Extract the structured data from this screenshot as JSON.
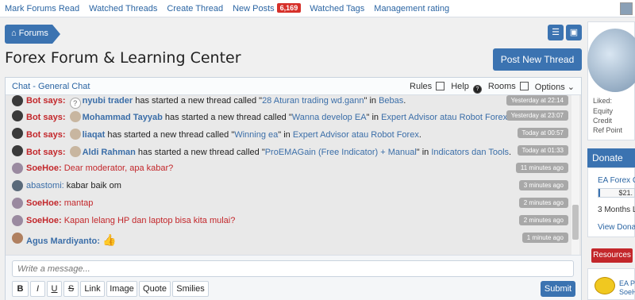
{
  "topnav": {
    "items": [
      "Mark Forums Read",
      "Watched Threads",
      "Create Thread",
      "New Posts"
    ],
    "new_posts_count": "6,169",
    "items2": [
      "Watched Tags",
      "Management rating"
    ]
  },
  "breadcrumb": {
    "label": "Forums"
  },
  "page": {
    "title": "Forex Forum & Learning Center",
    "post_button": "Post New Thread"
  },
  "chat": {
    "title": "Chat - General Chat",
    "tools": {
      "rules": "Rules",
      "help": "Help",
      "rooms": "Rooms",
      "options": "Options"
    },
    "messages": [
      {
        "speaker": "Bot says:",
        "user": "nyubi trader",
        "text": " has started a new thread called \"",
        "link": "28 Aturan trading wd.gann",
        "mid": "\" in ",
        "forum": "Bebas",
        "end": ".",
        "time": "Yesterday at 22:14"
      },
      {
        "speaker": "Bot says:",
        "user": "Mohammad Tayyab",
        "text": " has started a new thread called \"",
        "link": "Wanna develop EA",
        "mid": "\" in ",
        "forum": "Expert Advisor atau Robot Forex",
        "end": ".",
        "time": "Yesterday at 23:07"
      },
      {
        "speaker": "Bot says:",
        "user": "liaqat",
        "text": " has started a new thread called \"",
        "link": "Winning ea",
        "mid": "\" in ",
        "forum": "Expert Advisor atau Robot Forex",
        "end": ".",
        "time": "Today at 00:57"
      },
      {
        "speaker": "Bot says:",
        "user": "Aldi Rahman",
        "text": " has started a new thread called \"",
        "link": "ProEMAGain (Free Indicator) + Manual",
        "mid": "\" in ",
        "forum": "Indicators dan Tools",
        "end": ".",
        "time": "Today at 01:33"
      },
      {
        "user": "SoeHoe:",
        "text": "Dear moderator, apa kabar?",
        "time": "11 minutes ago"
      },
      {
        "user": "abastomi:",
        "text": "kabar baik om",
        "time": "3 minutes ago"
      },
      {
        "user": "SoeHoe:",
        "text": "mantap",
        "time": "2 minutes ago"
      },
      {
        "user": "SoeHoe:",
        "text": "Kapan lelang HP dan laptop bisa kita mulai?",
        "time": "2 minutes ago"
      },
      {
        "user": "Agus Mardiyanto:",
        "text": "",
        "time": "1 minute ago"
      }
    ],
    "input_placeholder": "Write a message...",
    "format_buttons": [
      "B",
      "I",
      "U",
      "S",
      "Link",
      "Image",
      "Quote",
      "Smilies"
    ],
    "submit": "Submit"
  },
  "sidebar": {
    "stats": [
      "Liked:",
      "Equity",
      "Credit",
      "Ref Point"
    ],
    "donate_title": "Donate",
    "donate_link": "EA Forex C",
    "donate_amount": "$21.",
    "donate_progress": 0.05,
    "donate_period": "3 Months L",
    "donate_view": "View Donat",
    "resources": "Resources",
    "item_title": "EA Pi",
    "item_user": "SoeH"
  }
}
